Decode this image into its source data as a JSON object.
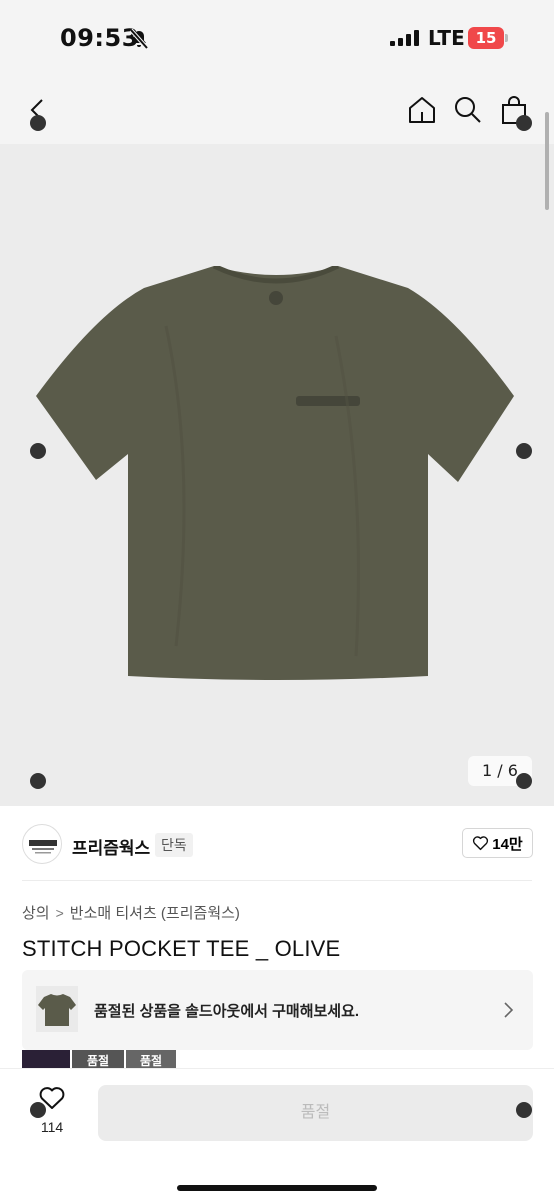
{
  "status_bar": {
    "time": "09:53",
    "network": "LTE",
    "battery": "15"
  },
  "nav": {
    "icons": [
      "chevron-left-icon",
      "home-icon",
      "search-icon",
      "shopping-bag-icon"
    ]
  },
  "product_image": {
    "counter": "1 / 6"
  },
  "brand": {
    "name": "프리즘웍스",
    "tag": "단독",
    "likes": "14만"
  },
  "breadcrumb": {
    "category": "상의",
    "subcategory": "반소매 티셔츠 (프리즘웍스)",
    "separator": ">"
  },
  "product": {
    "title": "STITCH POCKET TEE _ OLIVE"
  },
  "soldout_banner": {
    "text": "품절된 상품을 솔드아웃에서 구매해보세요."
  },
  "options": {
    "labels": [
      "",
      "품절",
      "품절"
    ]
  },
  "bottom_bar": {
    "wish_count": "114",
    "button_label": "품절"
  },
  "colors": {
    "tee_olive": "#5a5b4a",
    "battery_red": "#f0484a",
    "image_bg": "#ececec"
  }
}
